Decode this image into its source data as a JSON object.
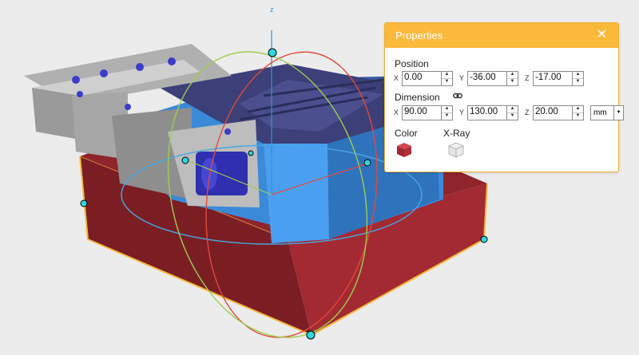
{
  "viewport": {
    "axis_label": "z"
  },
  "panel": {
    "title": "Properties",
    "close_icon": "close-icon",
    "position": {
      "label": "Position",
      "x_label": "X",
      "x_value": "0.00",
      "y_label": "Y",
      "y_value": "-36.00",
      "z_label": "Z",
      "z_value": "-17.00"
    },
    "dimension": {
      "label": "Dimension",
      "link_icon": "link-icon",
      "x_label": "X",
      "x_value": "90.00",
      "y_label": "Y",
      "y_value": "130.00",
      "z_label": "Z",
      "z_value": "20.00",
      "unit": "mm"
    },
    "color_label": "Color",
    "color_value": "#b3303a",
    "xray_label": "X-Ray"
  }
}
